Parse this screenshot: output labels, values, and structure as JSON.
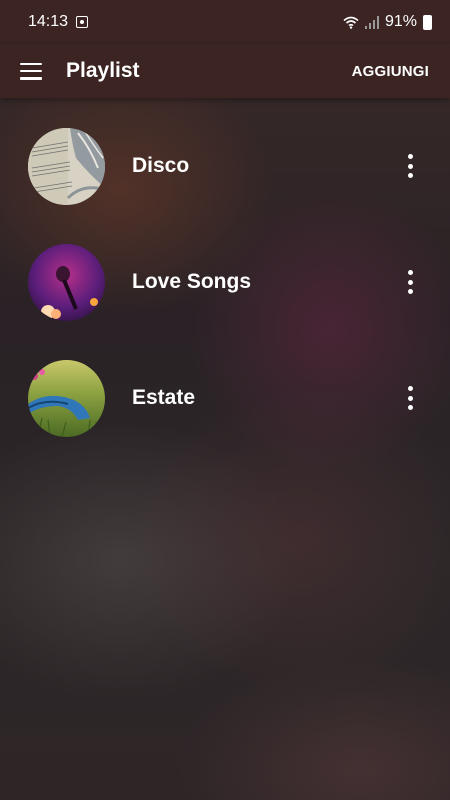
{
  "status_bar": {
    "time": "14:13",
    "battery": "91%",
    "icons": [
      "notification-icon",
      "wifi-icon",
      "signal-icon",
      "battery-charging-icon"
    ]
  },
  "app_bar": {
    "title": "Playlist",
    "add_label": "AGGIUNGI",
    "icons": [
      "menu-icon"
    ]
  },
  "playlists": [
    {
      "title": "Disco",
      "thumbnail": "sheet-music-image"
    },
    {
      "title": "Love Songs",
      "thumbnail": "microphone-image"
    },
    {
      "title": "Estate",
      "thumbnail": "headphones-grass-image"
    }
  ],
  "colors": {
    "app_bar": "#3b2422",
    "text": "#ffffff"
  }
}
